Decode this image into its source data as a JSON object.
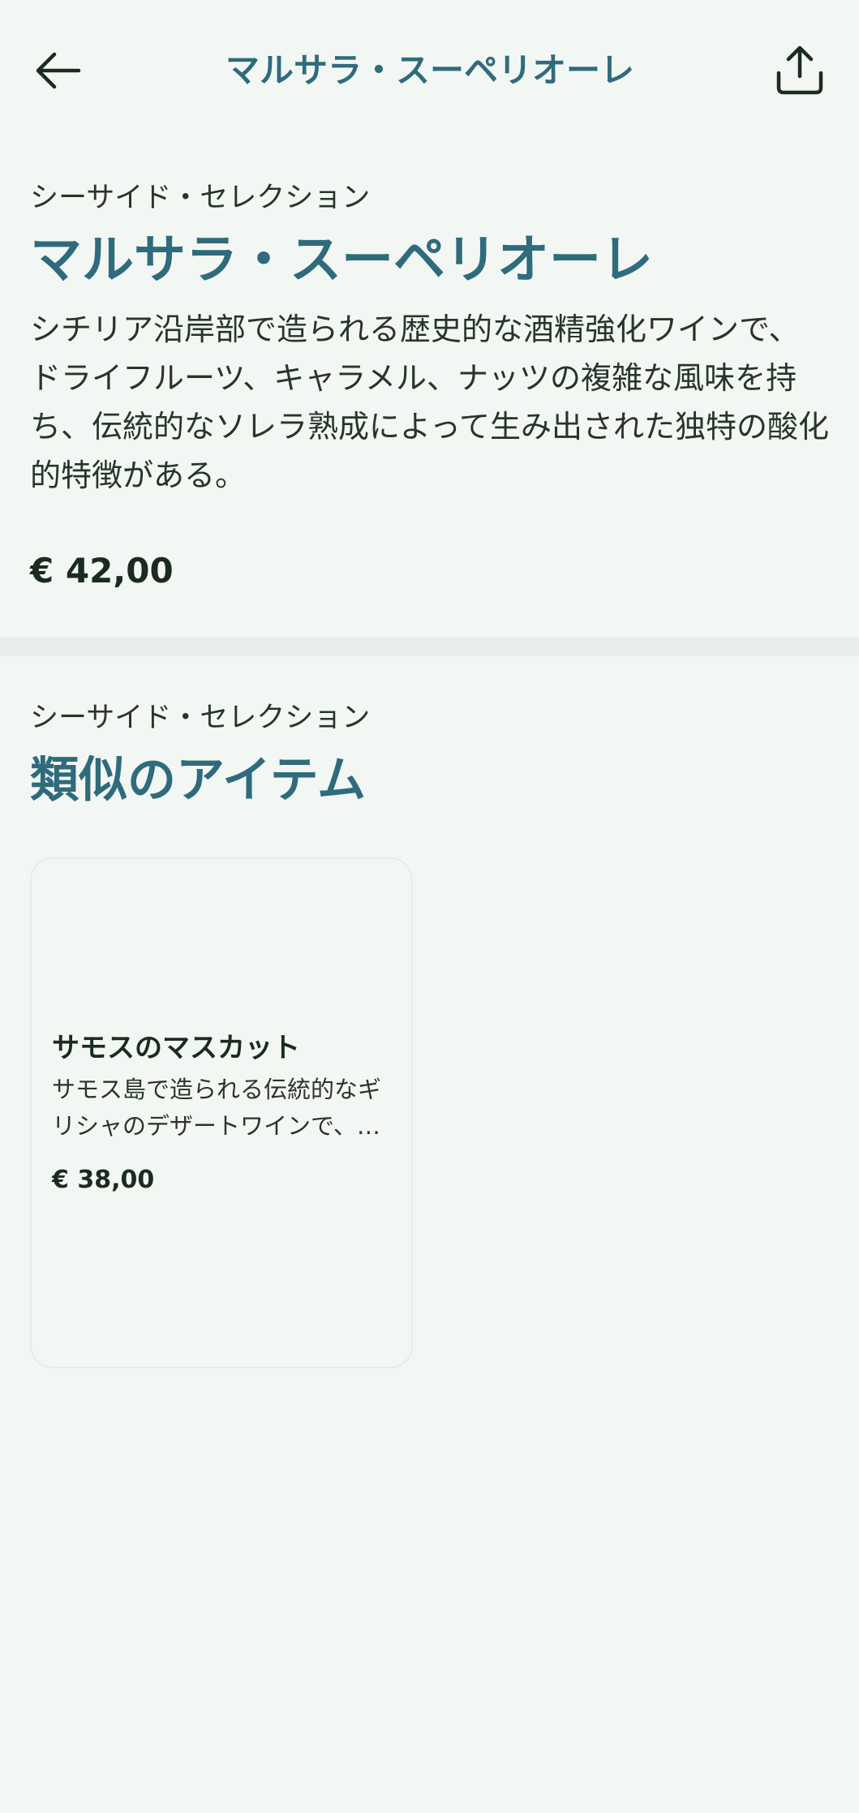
{
  "header": {
    "title": "マルサラ・スーペリオーレ",
    "back_icon": "arrow-left-icon",
    "share_icon": "share-icon"
  },
  "product": {
    "store": "シーサイド・セレクション",
    "name": "マルサラ・スーペリオーレ",
    "description": "シチリア沿岸部で造られる歴史的な酒精強化ワインで、ドライフルーツ、キャラメル、ナッツの複雑な風味を持ち、伝統的なソレラ熟成によって生み出された独特の酸化的特徴がある。",
    "price": "€ 42,00"
  },
  "similar": {
    "store": "シーサイド・セレクション",
    "title": "類似のアイテム",
    "items": [
      {
        "name": "サモスのマスカット",
        "description": "サモス島で造られる伝統的なギリシャのデザートワインで、…",
        "price": "€ 38,00"
      }
    ]
  },
  "colors": {
    "accent": "#2f6b7d",
    "background": "#f3f7f3",
    "text": "#1b2b22"
  }
}
